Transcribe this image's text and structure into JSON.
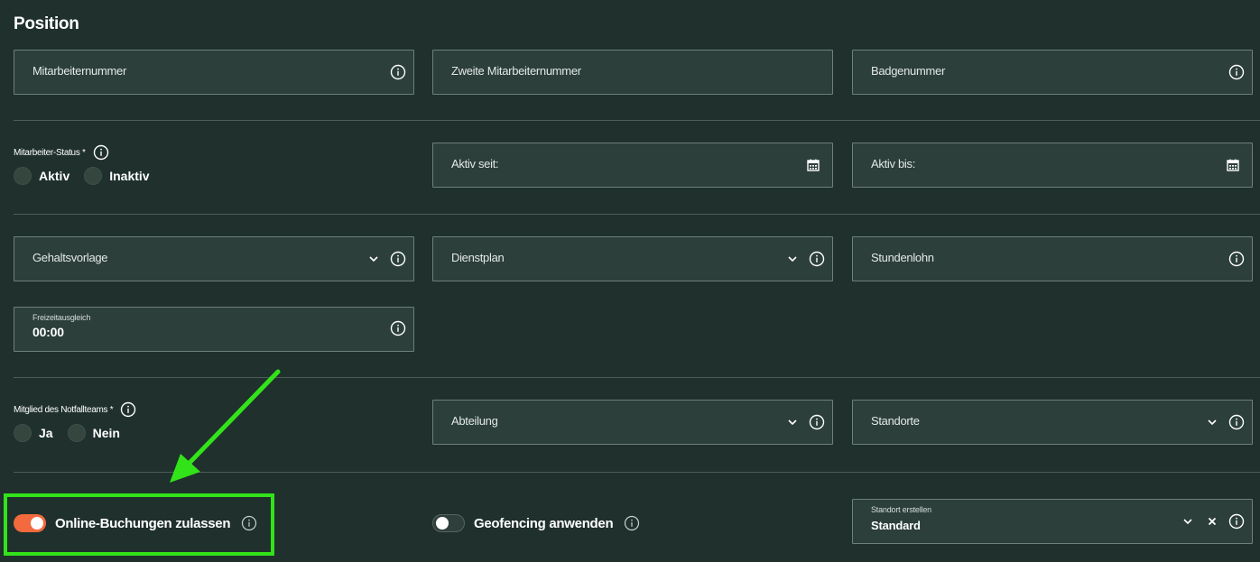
{
  "section_title": "Position",
  "fields": {
    "mitarbeiternummer": "Mitarbeiternummer",
    "zweite_mitarbeiternummer": "Zweite Mitarbeiternummer",
    "badgenummer": "Badgenummer",
    "aktiv_seit": "Aktiv seit:",
    "aktiv_bis": "Aktiv bis:",
    "gehaltsvorlage": "Gehaltsvorlage",
    "dienstplan": "Dienstplan",
    "stundenlohn": "Stundenlohn",
    "freizeitausgleich_label": "Freizeitausgleich",
    "freizeitausgleich_value": "00:00",
    "abteilung": "Abteilung",
    "standorte": "Standorte",
    "standort_erstellen_label": "Standort erstellen",
    "standort_erstellen_value": "Standard"
  },
  "status": {
    "label": "Mitarbeiter-Status *",
    "options": [
      "Aktiv",
      "Inaktiv"
    ]
  },
  "notfallteam": {
    "label": "Mitglied des Notfallteams *",
    "options": [
      "Ja",
      "Nein"
    ]
  },
  "toggles": {
    "online_buchungen": {
      "label": "Online-Buchungen zulassen",
      "on": true
    },
    "geofencing": {
      "label": "Geofencing anwenden",
      "on": false
    }
  },
  "icons": {
    "info": "info-icon",
    "calendar": "calendar-icon",
    "chevron": "chevron-down-icon",
    "clear": "close-icon"
  },
  "colors": {
    "background": "#1f302d",
    "field": "#2c3f3b",
    "toggle_on": "#f26a3d",
    "highlight": "#33e31a"
  }
}
